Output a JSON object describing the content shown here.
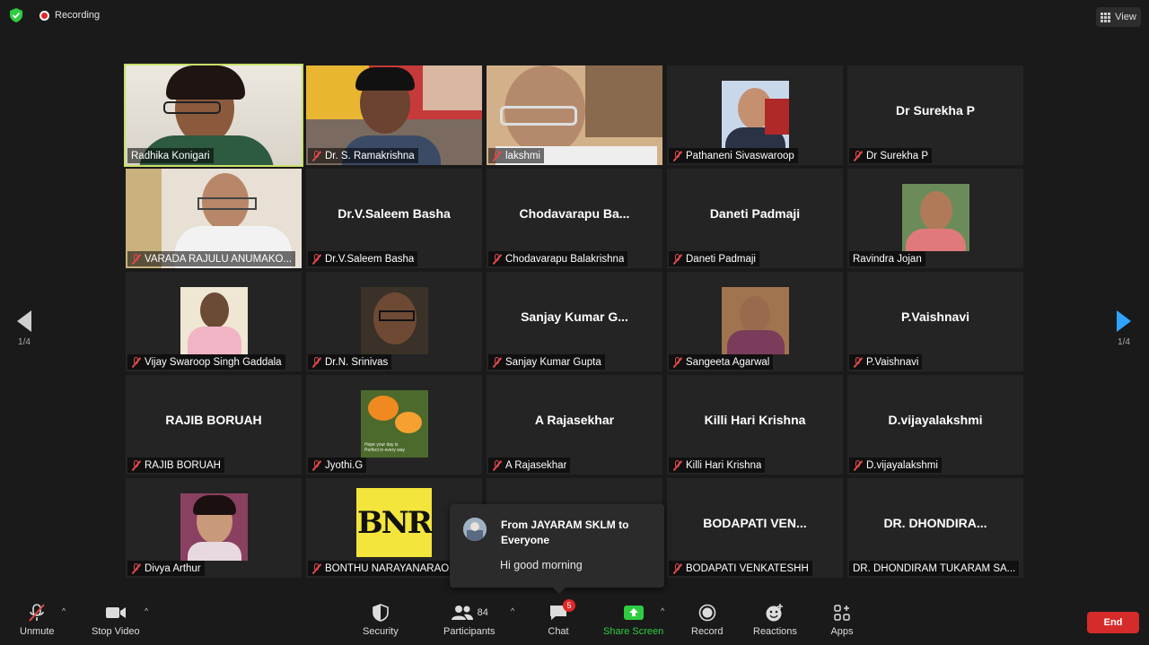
{
  "header": {
    "recording_label": "Recording",
    "view_label": "View"
  },
  "pager": {
    "left": "1/4",
    "right": "1/4"
  },
  "tiles": [
    {
      "label": "Radhika Konigari",
      "type": "video",
      "active": true,
      "muted": false
    },
    {
      "label": "Dr. S. Ramakrishna",
      "type": "video",
      "muted": true
    },
    {
      "label": "lakshmi",
      "type": "video",
      "muted": true
    },
    {
      "label": "Pathaneni Sivaswaroop",
      "type": "photo",
      "muted": true
    },
    {
      "label": "Dr Surekha P",
      "big": "Dr Surekha P",
      "type": "name",
      "muted": true
    },
    {
      "label": "VARADA RAJULU ANUMAKO...",
      "type": "video",
      "muted": true
    },
    {
      "label": "Dr.V.Saleem Basha",
      "big": "Dr.V.Saleem Basha",
      "type": "name",
      "muted": true
    },
    {
      "label": "Chodavarapu Balakrishna",
      "big": "Chodavarapu  Ba...",
      "type": "name",
      "muted": true
    },
    {
      "label": "Daneti Padmaji",
      "big": "Daneti Padmaji",
      "type": "name",
      "muted": true
    },
    {
      "label": "Ravindra Jojan",
      "type": "photo",
      "muted": false
    },
    {
      "label": "Vijay Swaroop Singh Gaddala",
      "type": "photo",
      "muted": true
    },
    {
      "label": "Dr.N. Srinivas",
      "type": "photo",
      "muted": true
    },
    {
      "label": "Sanjay Kumar Gupta",
      "big": "Sanjay  Kumar  G...",
      "type": "name",
      "muted": true
    },
    {
      "label": "Sangeeta Agarwal",
      "type": "photo",
      "muted": true
    },
    {
      "label": "P.Vaishnavi",
      "big": "P.Vaishnavi",
      "type": "name",
      "muted": true
    },
    {
      "label": "RAJIB BORUAH",
      "big": "RAJIB BORUAH",
      "type": "name",
      "muted": true
    },
    {
      "label": "Jyothi.G",
      "type": "flower",
      "muted": true
    },
    {
      "label": "A Rajasekhar",
      "big": "A Rajasekhar",
      "type": "name",
      "muted": true
    },
    {
      "label": "Killi Hari Krishna",
      "big": "Killi Hari Krishna",
      "type": "name",
      "muted": true
    },
    {
      "label": "D.vijayalakshmi",
      "big": "D.vijayalakshmi",
      "type": "name",
      "muted": true
    },
    {
      "label": "Divya Arthur",
      "type": "photo",
      "muted": true
    },
    {
      "label": "BONTHU NARAYANARAO",
      "type": "logo",
      "muted": true
    },
    {
      "label": "",
      "type": "name",
      "muted": false
    },
    {
      "label": "BODAPATI VENKATESHH",
      "big": "BODAPATI  VEN...",
      "type": "name",
      "muted": true
    },
    {
      "label": "DR. DHONDIRAM TUKARAM SA...",
      "big": "DR.  DHONDIRA...",
      "type": "name",
      "muted": false
    }
  ],
  "logo_text": "BNR",
  "flower_caption": "Hope your day is\nPerfect in every way",
  "chat_popup": {
    "from": "From JAYARAM SKLM to Everyone",
    "message": "Hi good morning"
  },
  "toolbar": {
    "unmute": "Unmute",
    "stop_video": "Stop Video",
    "security": "Security",
    "participants": "Participants",
    "participants_count": "84",
    "chat": "Chat",
    "chat_badge": "5",
    "share_screen": "Share Screen",
    "record": "Record",
    "reactions": "Reactions",
    "apps": "Apps",
    "end": "End"
  },
  "colors": {
    "active_speaker": "#c8e06a",
    "share_green": "#2ecc40",
    "end_red": "#d52b2b",
    "muted_red": "#e04a4a",
    "nav_blue": "#2fa3ff"
  }
}
